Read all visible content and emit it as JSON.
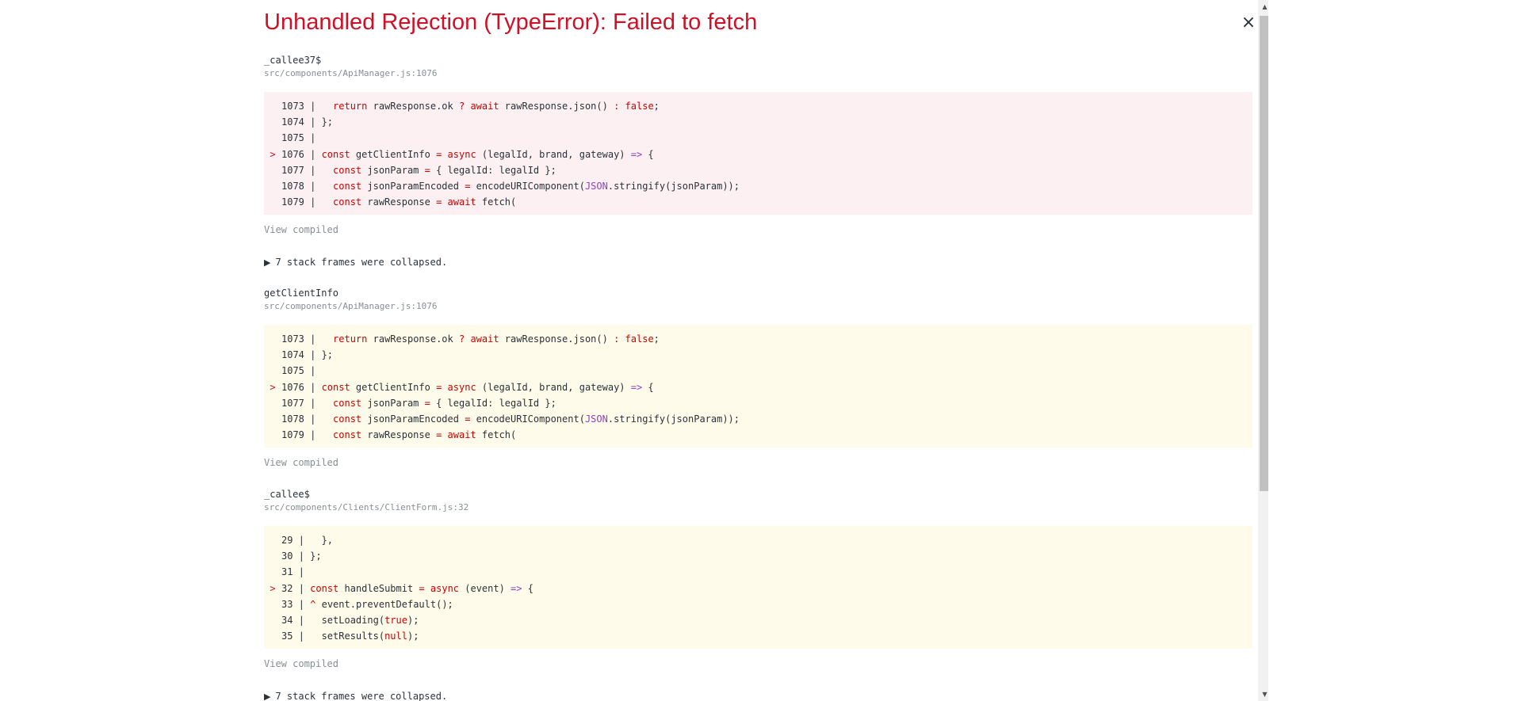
{
  "error": {
    "title": "Unhandled Rejection (TypeError): Failed to fetch",
    "close_label": "×"
  },
  "frames": [
    {
      "function": "_callee37$",
      "file": "src/components/ApiManager.js:1076",
      "view_compiled": "View compiled",
      "lines": [
        {
          "marker": "",
          "no": "1073",
          "html": "|   <span class=\"kw\">return</span> rawResponse.ok <span class=\"kw\">?</span> <span class=\"kw\">await</span> rawResponse.json() <span class=\"kw\">:</span> <span class=\"kw\">false</span>;"
        },
        {
          "marker": "",
          "no": "1074",
          "html": "| };"
        },
        {
          "marker": "",
          "no": "1075",
          "html": "|"
        },
        {
          "marker": ">",
          "no": "1076",
          "html": "| <span class=\"kw\">const</span> getClientInfo <span class=\"kw\">=</span> <span class=\"kw\">async</span> (legalId, brand, gateway) <span class=\"pu\">=&gt;</span> {"
        },
        {
          "marker": "",
          "no": "1077",
          "html": "|   <span class=\"kw\">const</span> jsonParam <span class=\"kw\">=</span> { legalId: legalId };"
        },
        {
          "marker": "",
          "no": "1078",
          "html": "|   <span class=\"kw\">const</span> jsonParamEncoded <span class=\"kw\">=</span> encodeURIComponent(<span class=\"pu\">JSON</span>.stringify(jsonParam));"
        },
        {
          "marker": "",
          "no": "1079",
          "html": "|   <span class=\"kw\">const</span> rawResponse <span class=\"kw\">=</span> <span class=\"kw\">await</span> fetch("
        }
      ]
    },
    {
      "function": "getClientInfo",
      "file": "src/components/ApiManager.js:1076",
      "view_compiled": "View compiled",
      "lines": [
        {
          "marker": "",
          "no": "1073",
          "html": "|   <span class=\"kw\">return</span> rawResponse.ok <span class=\"kw\">?</span> <span class=\"kw\">await</span> rawResponse.json() <span class=\"kw\">:</span> <span class=\"kw\">false</span>;"
        },
        {
          "marker": "",
          "no": "1074",
          "html": "| };"
        },
        {
          "marker": "",
          "no": "1075",
          "html": "|"
        },
        {
          "marker": ">",
          "no": "1076",
          "html": "| <span class=\"kw\">const</span> getClientInfo <span class=\"kw\">=</span> <span class=\"kw\">async</span> (legalId, brand, gateway) <span class=\"pu\">=&gt;</span> {"
        },
        {
          "marker": "",
          "no": "1077",
          "html": "|   <span class=\"kw\">const</span> jsonParam <span class=\"kw\">=</span> { legalId: legalId };"
        },
        {
          "marker": "",
          "no": "1078",
          "html": "|   <span class=\"kw\">const</span> jsonParamEncoded <span class=\"kw\">=</span> encodeURIComponent(<span class=\"pu\">JSON</span>.stringify(jsonParam));"
        },
        {
          "marker": "",
          "no": "1079",
          "html": "|   <span class=\"kw\">const</span> rawResponse <span class=\"kw\">=</span> <span class=\"kw\">await</span> fetch("
        }
      ]
    },
    {
      "function": "_callee$",
      "file": "src/components/Clients/ClientForm.js:32",
      "view_compiled": "View compiled",
      "lines": [
        {
          "marker": "",
          "no": "29",
          "html": "|   },"
        },
        {
          "marker": "",
          "no": "30",
          "html": "| };"
        },
        {
          "marker": "",
          "no": "31",
          "html": "|"
        },
        {
          "marker": ">",
          "no": "32",
          "html": "| <span class=\"kw\">const</span> handleSubmit <span class=\"kw\">=</span> <span class=\"kw\">async</span> (event) <span class=\"pu\">=&gt;</span> {"
        },
        {
          "marker": "",
          "no": "33",
          "html": "| <span class=\"kw\">^</span> event.preventDefault();"
        },
        {
          "marker": "",
          "no": "34",
          "html": "|   setLoading(<span class=\"kw\">true</span>);"
        },
        {
          "marker": "",
          "no": "35",
          "html": "|   setResults(<span class=\"kw\">null</span>);"
        }
      ]
    }
  ],
  "collapsed": [
    "7 stack frames were collapsed.",
    "7 stack frames were collapsed."
  ],
  "icons": {
    "triangle": "▶",
    "scroll_up": "▲",
    "scroll_down": "▼"
  },
  "colors": {
    "title": "#ce1126",
    "keyword": "#cd0000",
    "purple": "#8f42b9",
    "code_bg_primary": "#fcf0f2",
    "code_bg_secondary": "#fffbea"
  }
}
